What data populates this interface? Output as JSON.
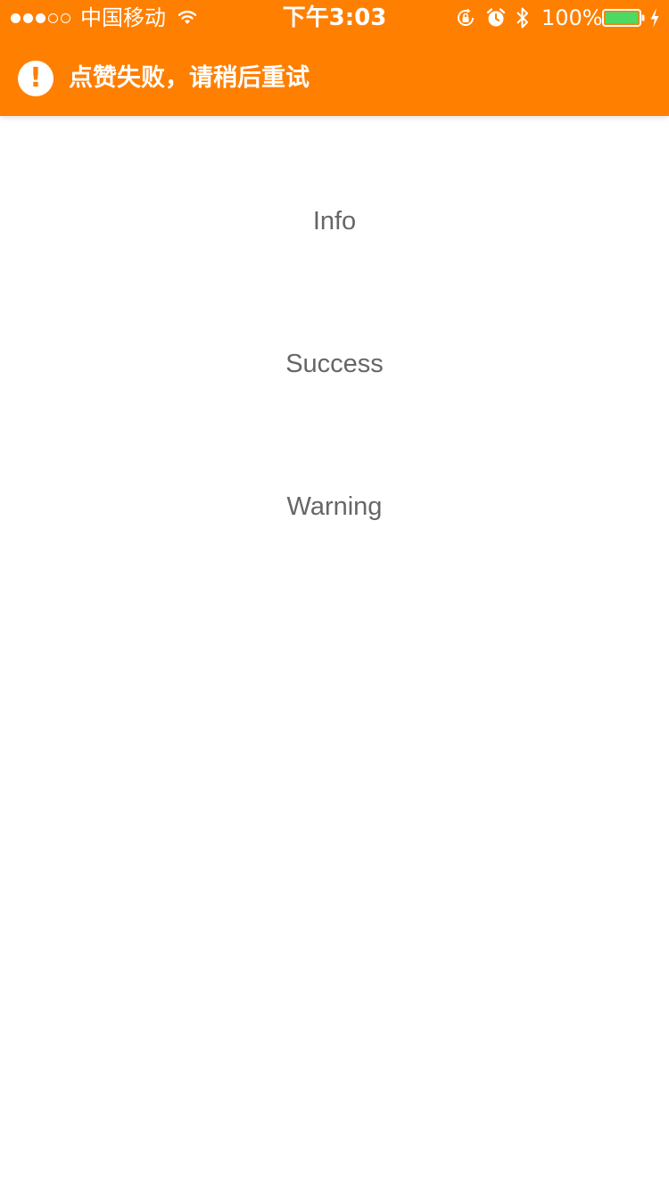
{
  "status_bar": {
    "carrier": "中国移动",
    "time": "下午3:03",
    "battery_percent": "100%",
    "signal_strength": 3,
    "signal_max": 5,
    "battery_level": 1.0,
    "icons": [
      "wifi-icon",
      "rotation-lock-icon",
      "alarm-icon",
      "bluetooth-icon",
      "battery-icon",
      "charging-icon"
    ]
  },
  "toast": {
    "icon": "exclamation-circle-icon",
    "icon_glyph": "!",
    "message": "点赞失败，请稍后重试",
    "background_color": "#ff7f00"
  },
  "buttons": {
    "info": "Info",
    "success": "Success",
    "warning": "Warning"
  },
  "colors": {
    "accent": "#ff7f00",
    "button_text": "#666666",
    "battery_fill": "#4cd964"
  }
}
